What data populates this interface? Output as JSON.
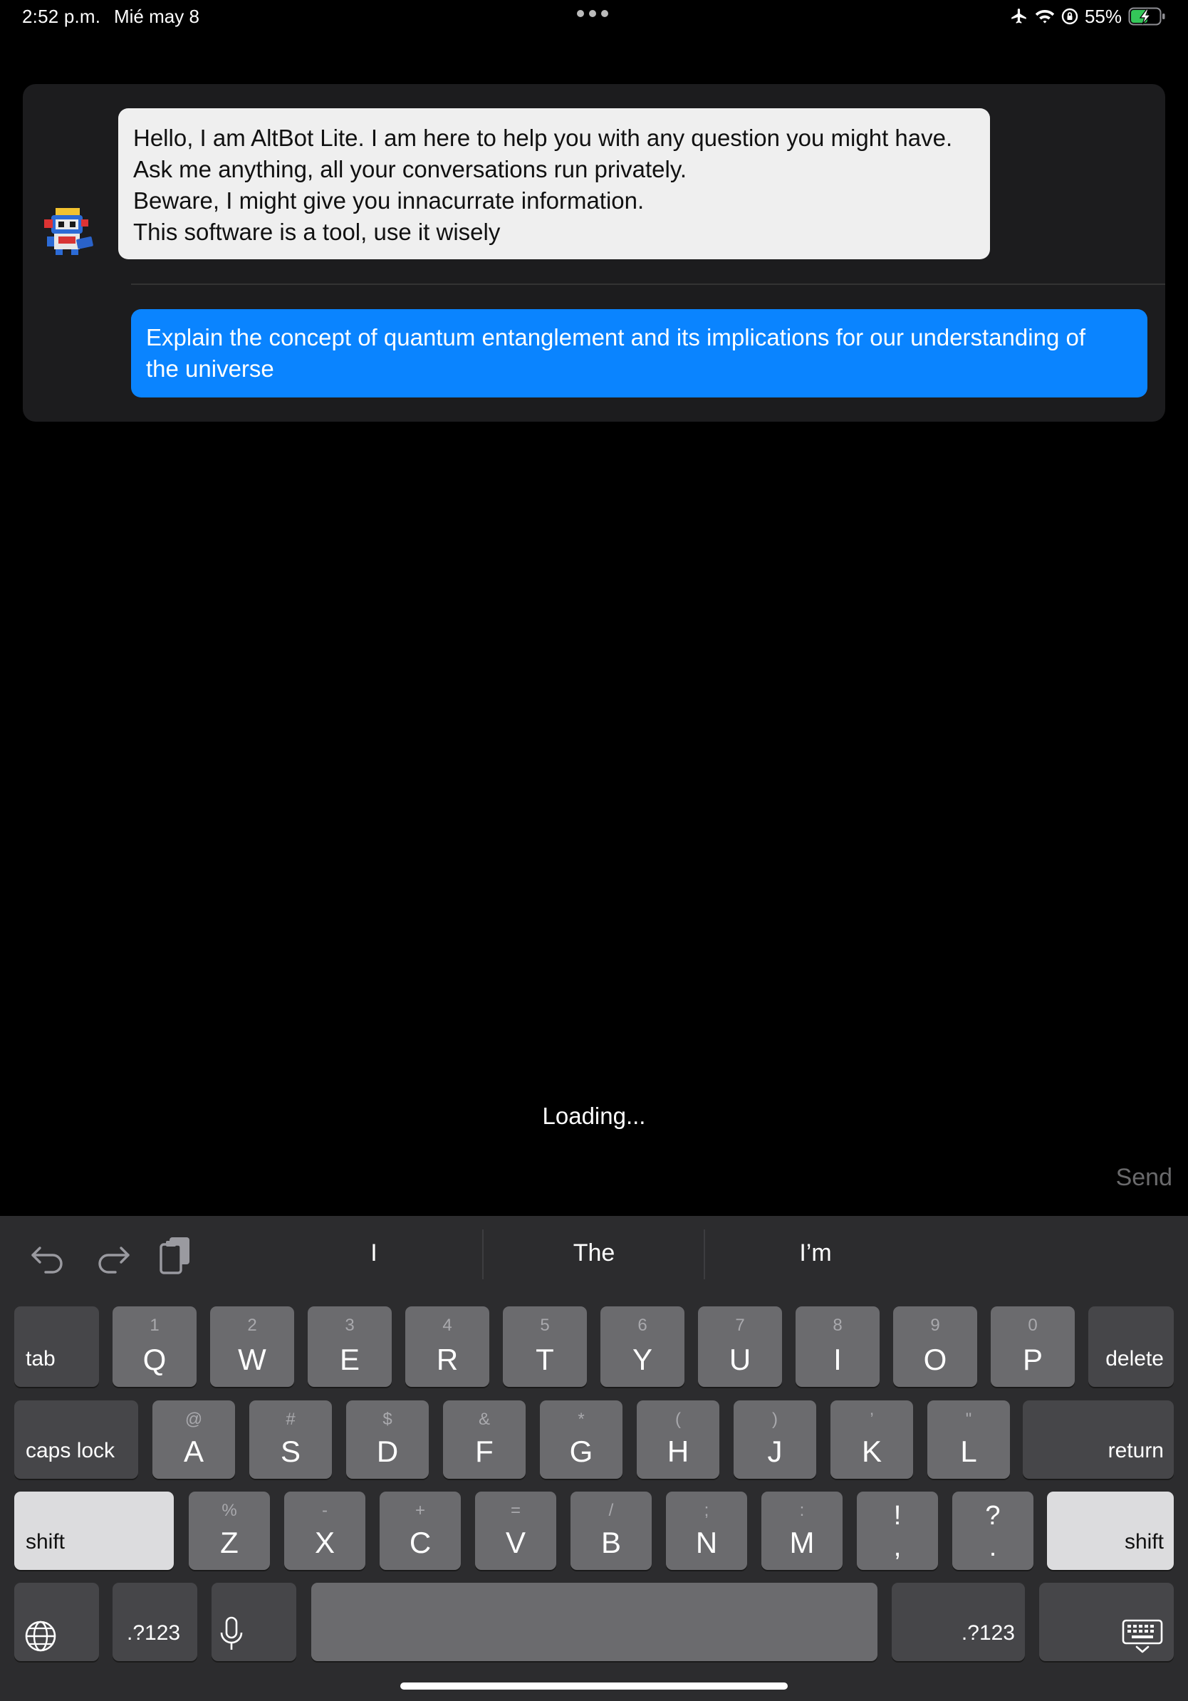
{
  "status_bar": {
    "time": "2:52 p.m.",
    "date": "Mié may 8",
    "battery": "55%",
    "icons": [
      "airplane-icon",
      "wifi-icon",
      "orientation-lock-icon",
      "battery-charging-icon"
    ]
  },
  "chat": {
    "bot_message": [
      "Hello, I am AltBot Lite. I am here to help you with any question you might have.",
      "Ask me anything, all your conversations run privately.",
      "Beware, I might give you innacurrate information.",
      "This software is a tool, use it wisely"
    ],
    "user_message": [
      "Explain the concept of quantum entanglement and its implications for our understanding of",
      "the universe"
    ]
  },
  "status_text": "Loading...",
  "send_label": "Send",
  "colors": {
    "user_bubble": "#0a84ff",
    "bot_bubble": "#efefef",
    "panel": "#1c1c1e",
    "keyboard": "#2c2c2e"
  },
  "keyboard": {
    "toolbar_icons": [
      "undo-icon",
      "redo-icon",
      "clipboard-icon"
    ],
    "suggestions": [
      "I",
      "The",
      "I’m"
    ],
    "row1": [
      {
        "key": "Q",
        "alt": "1"
      },
      {
        "key": "W",
        "alt": "2"
      },
      {
        "key": "E",
        "alt": "3"
      },
      {
        "key": "R",
        "alt": "4"
      },
      {
        "key": "T",
        "alt": "5"
      },
      {
        "key": "Y",
        "alt": "6"
      },
      {
        "key": "U",
        "alt": "7"
      },
      {
        "key": "I",
        "alt": "8"
      },
      {
        "key": "O",
        "alt": "9"
      },
      {
        "key": "P",
        "alt": "0"
      }
    ],
    "row2": [
      {
        "key": "A",
        "alt": "@"
      },
      {
        "key": "S",
        "alt": "#"
      },
      {
        "key": "D",
        "alt": "$"
      },
      {
        "key": "F",
        "alt": "&"
      },
      {
        "key": "G",
        "alt": "*"
      },
      {
        "key": "H",
        "alt": "("
      },
      {
        "key": "J",
        "alt": ")"
      },
      {
        "key": "K",
        "alt": "’"
      },
      {
        "key": "L",
        "alt": "\""
      }
    ],
    "row3": [
      {
        "key": "Z",
        "alt": "%"
      },
      {
        "key": "X",
        "alt": "-"
      },
      {
        "key": "C",
        "alt": "+"
      },
      {
        "key": "V",
        "alt": "="
      },
      {
        "key": "B",
        "alt": "/"
      },
      {
        "key": "N",
        "alt": ";"
      },
      {
        "key": "M",
        "alt": ":"
      }
    ],
    "punct1": {
      "top": "!",
      "bottom": ","
    },
    "punct2": {
      "top": "?",
      "bottom": "."
    },
    "tab": "tab",
    "delete": "delete",
    "caps_lock": "caps lock",
    "return": "return",
    "shift": "shift",
    "numbers": ".?123",
    "bottom_icons": [
      "globe-icon",
      "microphone-icon",
      "keyboard-dismiss-icon"
    ]
  }
}
